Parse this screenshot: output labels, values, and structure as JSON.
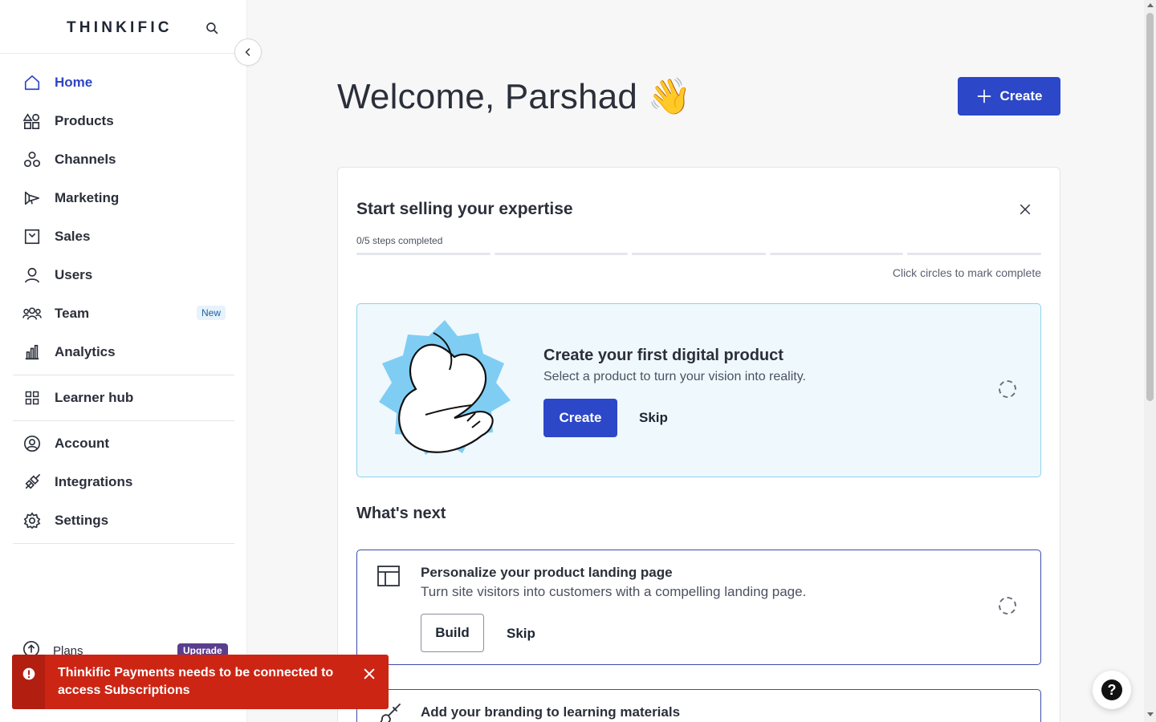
{
  "sidebar": {
    "logo": "THINKIFIC",
    "nav": [
      {
        "label": "Home",
        "icon": "home-icon",
        "active": true
      },
      {
        "label": "Products",
        "icon": "shapes-icon"
      },
      {
        "label": "Channels",
        "icon": "channels-icon"
      },
      {
        "label": "Marketing",
        "icon": "megaphone-icon"
      },
      {
        "label": "Sales",
        "icon": "sales-icon"
      },
      {
        "label": "Users",
        "icon": "user-icon"
      },
      {
        "label": "Team",
        "icon": "team-icon",
        "badge": "New"
      },
      {
        "label": "Analytics",
        "icon": "bar-chart-icon"
      }
    ],
    "nav2": [
      {
        "label": "Learner hub",
        "icon": "grid-icon"
      }
    ],
    "nav3": [
      {
        "label": "Account",
        "icon": "account-icon"
      },
      {
        "label": "Integrations",
        "icon": "plug-icon"
      },
      {
        "label": "Settings",
        "icon": "gear-icon"
      }
    ],
    "plans": {
      "label": "Plans",
      "badge": "Upgrade"
    }
  },
  "toast": {
    "message": "Thinkific Payments needs to be connected to access Subscriptions"
  },
  "main": {
    "welcome": "Welcome, Parshad 👋",
    "create_button": "Create",
    "card": {
      "title": "Start selling your expertise",
      "steps": "0/5 steps completed",
      "hint": "Click circles to mark complete",
      "feature": {
        "title": "Create your first digital product",
        "subtitle": "Select a product to turn your vision into reality.",
        "primary": "Create",
        "skip": "Skip"
      },
      "next_title": "What's next",
      "tasks": [
        {
          "title": "Personalize your product landing page",
          "subtitle": "Turn site visitors into customers with a compelling landing page.",
          "primary": "Build",
          "skip": "Skip"
        },
        {
          "title": "Add your branding to learning materials"
        }
      ]
    }
  },
  "colors": {
    "accent": "#2c47c8",
    "toast": "#cc2514",
    "feature_bg": "#eff8fd",
    "feature_border": "#8fd3ec"
  }
}
